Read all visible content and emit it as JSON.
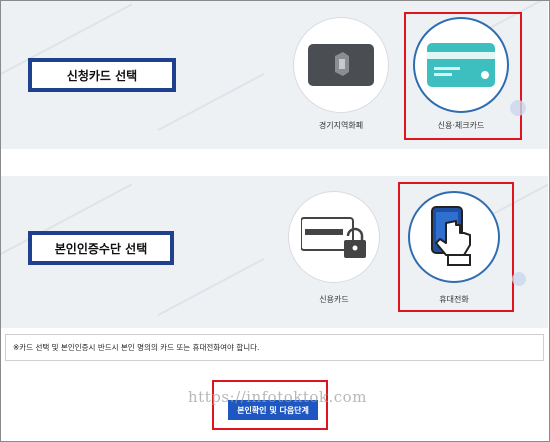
{
  "card_section": {
    "title": "신청카드 선택",
    "options": [
      {
        "caption": "경기지역화폐",
        "icon": "gyeonggi-local-currency-card-icon",
        "selected": false
      },
      {
        "caption": "신용·체크카드",
        "icon": "credit-check-card-icon",
        "selected": true
      }
    ]
  },
  "auth_section": {
    "title": "본인인증수단 선택",
    "options": [
      {
        "caption": "신용카드",
        "icon": "credit-card-lock-icon",
        "selected": false
      },
      {
        "caption": "휴대전화",
        "icon": "mobile-phone-hand-icon",
        "selected": true
      }
    ]
  },
  "notice": "※카드 선택 및 본인인증시 반드시 본인 명의의 카드 또는 휴대전화여야 합니다.",
  "next_button": "본인확인 및 다음단계",
  "watermark": "https://infotoktok.com",
  "colors": {
    "accent": "#1e57c2",
    "highlight": "#e0141e",
    "label_border": "#1f3f8f",
    "teal_card": "#3ebfbf"
  }
}
